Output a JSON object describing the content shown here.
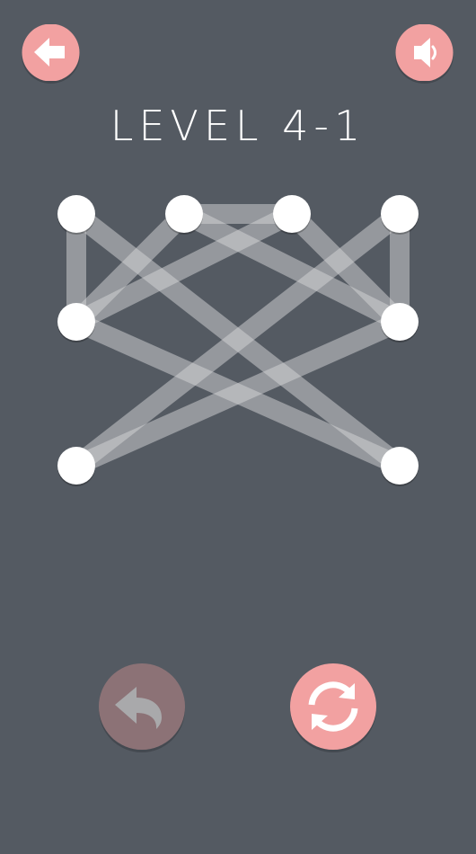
{
  "title": "LEVEL 4-1",
  "colors": {
    "background": "#545a62",
    "accent": "#f2a1a1",
    "accent_disabled": "#8c7276",
    "icon": "#ffffff",
    "icon_disabled": "#a9a9ab",
    "edge": "#d6d6d8",
    "node": "#ffffff"
  },
  "buttons": {
    "back": {
      "icon": "arrow-left-icon"
    },
    "sound": {
      "icon": "speaker-icon"
    },
    "undo": {
      "icon": "undo-arrow-icon",
      "enabled": false
    },
    "restart": {
      "icon": "refresh-icon",
      "enabled": true
    }
  },
  "puzzle": {
    "nodes": [
      {
        "id": "n1",
        "col": 0,
        "row": 0
      },
      {
        "id": "n2",
        "col": 1,
        "row": 0
      },
      {
        "id": "n3",
        "col": 2,
        "row": 0
      },
      {
        "id": "n4",
        "col": 3,
        "row": 0
      },
      {
        "id": "n5",
        "col": 0,
        "row": 1
      },
      {
        "id": "n6",
        "col": 3,
        "row": 1
      },
      {
        "id": "n7",
        "col": 0,
        "row": 2
      },
      {
        "id": "n8",
        "col": 3,
        "row": 2
      }
    ],
    "edges": [
      [
        "n1",
        "n5"
      ],
      [
        "n1",
        "n8"
      ],
      [
        "n2",
        "n3"
      ],
      [
        "n2",
        "n5"
      ],
      [
        "n2",
        "n6"
      ],
      [
        "n3",
        "n5"
      ],
      [
        "n3",
        "n6"
      ],
      [
        "n4",
        "n6"
      ],
      [
        "n4",
        "n7"
      ],
      [
        "n5",
        "n8"
      ],
      [
        "n6",
        "n7"
      ]
    ]
  }
}
